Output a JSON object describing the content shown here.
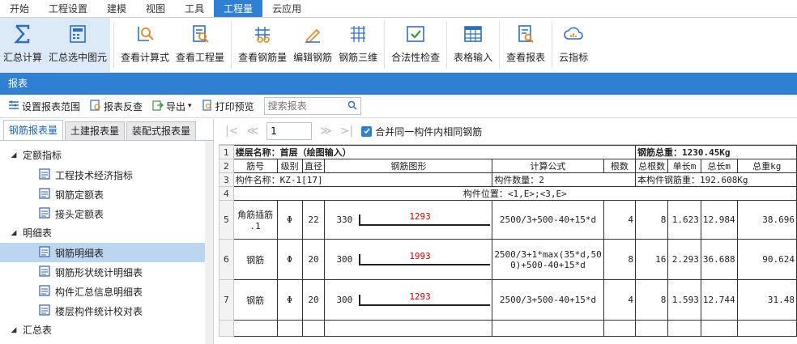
{
  "menu": [
    "开始",
    "工程设置",
    "建模",
    "视图",
    "工具",
    "工程量",
    "云应用"
  ],
  "ribbon": {
    "buttons": [
      {
        "label": "汇总计算",
        "icon": "sigma-icon"
      },
      {
        "label": "汇总选中图元",
        "icon": "calculator-icon"
      },
      {
        "label": "查看计算式",
        "icon": "view-formula-icon"
      },
      {
        "label": "查看工程量",
        "icon": "view-quantity-icon"
      },
      {
        "label": "查看钢筋量",
        "icon": "view-rebar-icon"
      },
      {
        "label": "编辑钢筋",
        "icon": "edit-rebar-icon"
      },
      {
        "label": "钢筋三维",
        "icon": "rebar-3d-icon"
      },
      {
        "label": "合法性检查",
        "icon": "check-icon"
      },
      {
        "label": "表格输入",
        "icon": "table-input-icon"
      },
      {
        "label": "查看报表",
        "icon": "view-report-icon"
      },
      {
        "label": "云指标",
        "icon": "cloud-indicator-icon"
      }
    ]
  },
  "panel_title": "报表",
  "toolbar": {
    "set_range": "设置报表范围",
    "reverse_check": "报表反查",
    "export": "导出",
    "print_preview": "打印预览",
    "search_placeholder": "搜索报表"
  },
  "left_tabs": [
    "钢筋报表量",
    "土建报表量",
    "装配式报表量"
  ],
  "tree": {
    "group1": "定额指标",
    "group1_items": [
      "工程技术经济指标",
      "钢筋定额表",
      "接头定额表"
    ],
    "group2": "明细表",
    "group2_items": [
      "钢筋明细表",
      "钢筋形状统计明细表",
      "构件汇总信息明细表",
      "楼层构件统计校对表"
    ],
    "group3": "汇总表"
  },
  "pager": {
    "page": "1",
    "merge_label": "合并同一构件内相同钢筋"
  },
  "report": {
    "row1": {
      "n": "1",
      "floor": "楼层名称：首层（绘图输入）",
      "total": "钢筋总重：1230.45Kg"
    },
    "row2": {
      "n": "2",
      "cols": [
        "筋号",
        "级别",
        "直径",
        "钢筋图形",
        "计算公式",
        "根数",
        "总根数",
        "单长m",
        "总长m",
        "总重kg"
      ]
    },
    "row3": {
      "n": "3",
      "name": "构件名称：KZ-1[17]",
      "count": "构件数量：2",
      "weight": "本构件钢筋重：192.608Kg"
    },
    "row4": {
      "n": "4",
      "pos": "构件位置：<1,E>;<3,E>"
    },
    "rows": [
      {
        "n": "5",
        "id1": "角筋插筋",
        "id2": ".1",
        "grade": "Φ",
        "dia": "22",
        "left": "330",
        "len": "1293",
        "formula": "2500/3+500-40+15*d",
        "formula2": "",
        "cnt": "4",
        "total": "8",
        "unit": "1.623",
        "tlen": "12.984",
        "tw": "38.696"
      },
      {
        "n": "6",
        "id1": "钢筋",
        "id2": "",
        "grade": "Φ",
        "dia": "20",
        "left": "300",
        "len": "1993",
        "formula": "2500/3+1*max(35*d,50",
        "formula2": "0)+500-40+15*d",
        "cnt": "8",
        "total": "16",
        "unit": "2.293",
        "tlen": "36.688",
        "tw": "90.624"
      },
      {
        "n": "7",
        "id1": "钢筋",
        "id2": "",
        "grade": "Φ",
        "dia": "20",
        "left": "300",
        "len": "1293",
        "formula": "2500/3+500-40+15*d",
        "formula2": "",
        "cnt": "4",
        "total": "8",
        "unit": "1.593",
        "tlen": "12.744",
        "tw": "31.48"
      }
    ]
  },
  "colors": {
    "accent": "#2f7fd2",
    "selected": "#bdd6f0",
    "shape_label": "#d00000"
  }
}
